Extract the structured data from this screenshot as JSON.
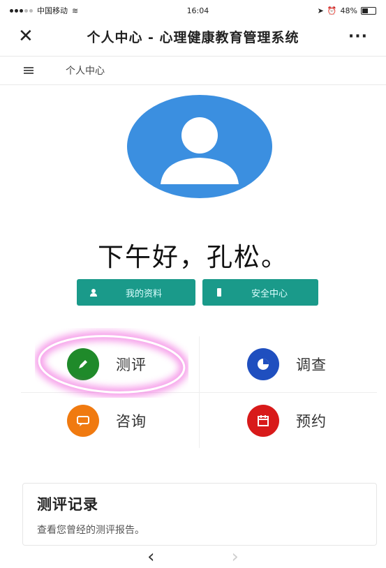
{
  "status_bar": {
    "carrier": "中国移动",
    "time": "16:04",
    "battery": "48%"
  },
  "nav": {
    "close_icon": "close-icon",
    "title": "个人中心 - 心理健康教育管理系统",
    "more_icon": "more-icon"
  },
  "breadcrumb": {
    "menu_icon": "menu-icon",
    "label": "个人中心"
  },
  "profile": {
    "avatar_icon": "user-avatar-icon",
    "avatar_color": "#3b8fe0",
    "greeting": "下午好，孔松。"
  },
  "actions": {
    "accent": "#1a9a8a",
    "profile_label": "我的资料",
    "security_label": "安全中心"
  },
  "features": [
    {
      "label": "测评",
      "icon": "pencil-icon",
      "color": "#1f8a2a"
    },
    {
      "label": "调查",
      "icon": "pie-chart-icon",
      "color": "#1f4fbf"
    },
    {
      "label": "咨询",
      "icon": "chat-icon",
      "color": "#f07a10"
    },
    {
      "label": "预约",
      "icon": "calendar-icon",
      "color": "#d81a1a"
    }
  ],
  "highlight_color": "#ee4fd8",
  "record_card": {
    "title": "测评记录",
    "description": "查看您曾经的测评报告。"
  },
  "bottom_nav": {
    "back_icon": "back-arrow-icon",
    "forward_icon": "forward-arrow-icon"
  }
}
